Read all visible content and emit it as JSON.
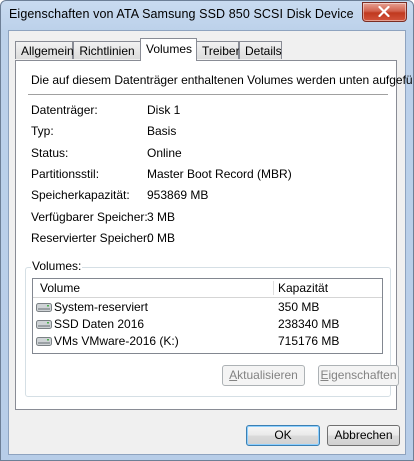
{
  "window": {
    "title": "Eigenschaften von ATA Samsung SSD 850 SCSI Disk Device"
  },
  "tabs": [
    {
      "label": "Allgemein"
    },
    {
      "label": "Richtlinien"
    },
    {
      "label": "Volumes"
    },
    {
      "label": "Treiber"
    },
    {
      "label": "Details"
    }
  ],
  "active_tab": "Volumes",
  "intro": "Die auf diesem Datenträger enthaltenen Volumes werden unten aufgeführt.",
  "properties": [
    {
      "label": "Datenträger:",
      "value": "Disk 1"
    },
    {
      "label": "Typ:",
      "value": "Basis"
    },
    {
      "label": "Status:",
      "value": "Online"
    },
    {
      "label": "Partitionsstil:",
      "value": "Master Boot Record (MBR)"
    },
    {
      "label": "Speicherkapazität:",
      "value": "953869 MB"
    },
    {
      "label": "Verfügbarer Speicher:",
      "value": "3 MB"
    },
    {
      "label": "Reservierter Speicher:",
      "value": "0 MB"
    }
  ],
  "volumes": {
    "group_label": "Volumes:",
    "columns": [
      "Volume",
      "Kapazität"
    ],
    "rows": [
      {
        "name": "System-reserviert",
        "capacity": "350 MB",
        "icon": "drive-icon"
      },
      {
        "name": "SSD Daten 2016",
        "capacity": "238340 MB",
        "icon": "drive-icon"
      },
      {
        "name": "VMs VMware-2016 (K:)",
        "capacity": "715176 MB",
        "icon": "drive-icon"
      }
    ]
  },
  "buttons": {
    "refresh_pre": "",
    "refresh_u": "A",
    "refresh_post": "ktualisieren",
    "props_pre": "",
    "props_u": "E",
    "props_post": "igenschaften",
    "ok": "OK",
    "cancel": "Abbrechen"
  }
}
